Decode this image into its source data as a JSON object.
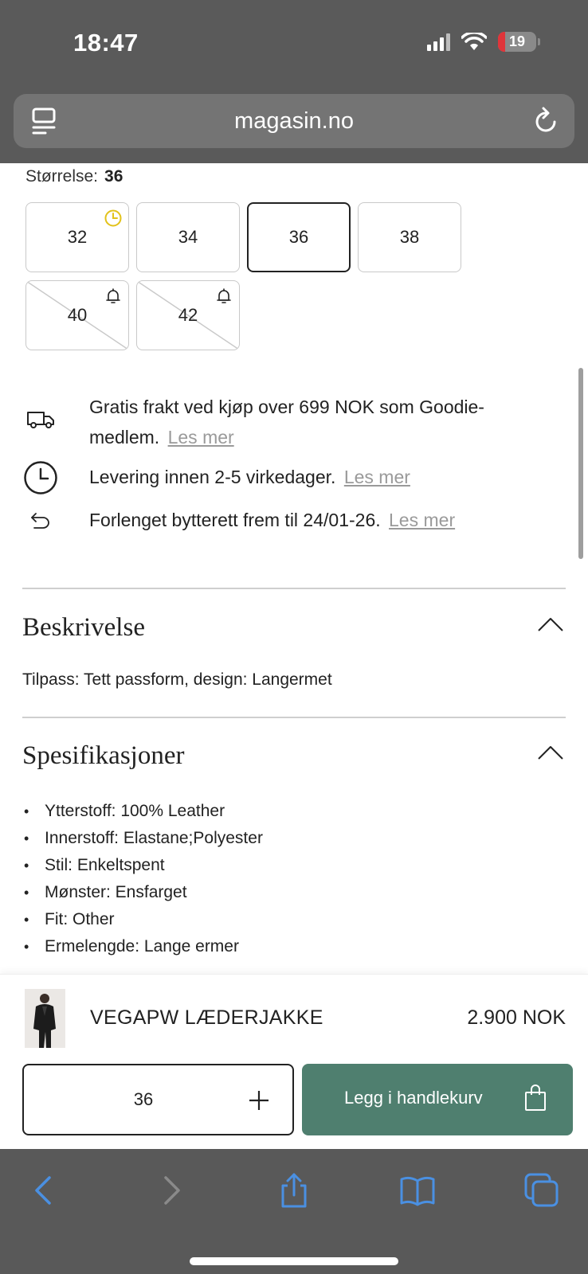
{
  "status_bar": {
    "time": "18:47",
    "battery": "19"
  },
  "browser": {
    "url": "magasin.no"
  },
  "size_selector": {
    "label": "Størrelse:",
    "selected": "36",
    "options": [
      {
        "label": "32",
        "state": "low-stock"
      },
      {
        "label": "34",
        "state": "available"
      },
      {
        "label": "36",
        "state": "selected"
      },
      {
        "label": "38",
        "state": "available"
      },
      {
        "label": "40",
        "state": "sold-out-notify"
      },
      {
        "label": "42",
        "state": "sold-out-notify"
      }
    ]
  },
  "info": {
    "shipping_text": "Gratis frakt ved kjøp over 699 NOK som Goodie-medlem.",
    "shipping_link": "Les mer",
    "delivery_text": "Levering innen 2-5 virkedager.",
    "delivery_link": "Les mer",
    "return_text": "Forlenget bytterett frem til 24/01-26.",
    "return_link": "Les mer"
  },
  "description": {
    "title": "Beskrivelse",
    "text": "Tilpass: Tett passform, design: Langermet"
  },
  "specifications": {
    "title": "Spesifikasjoner",
    "items": [
      "Ytterstoff: 100% Leather",
      "Innerstoff: Elastane;Polyester",
      "Stil: Enkeltspent",
      "Mønster: Ensfarget",
      "Fit: Other",
      "Ermelengde: Lange ermer"
    ]
  },
  "sticky_bar": {
    "product_name": "VEGAPW LÆDERJAKKE",
    "price": "2.900 NOK",
    "quantity_size": "36",
    "add_to_cart": "Legg i handlekurv"
  },
  "colors": {
    "accent_green": "#4f7f6f",
    "low_stock_yellow": "#e2c21a",
    "link_gray": "#9a9a9a",
    "ios_blue": "#4a90e2"
  }
}
